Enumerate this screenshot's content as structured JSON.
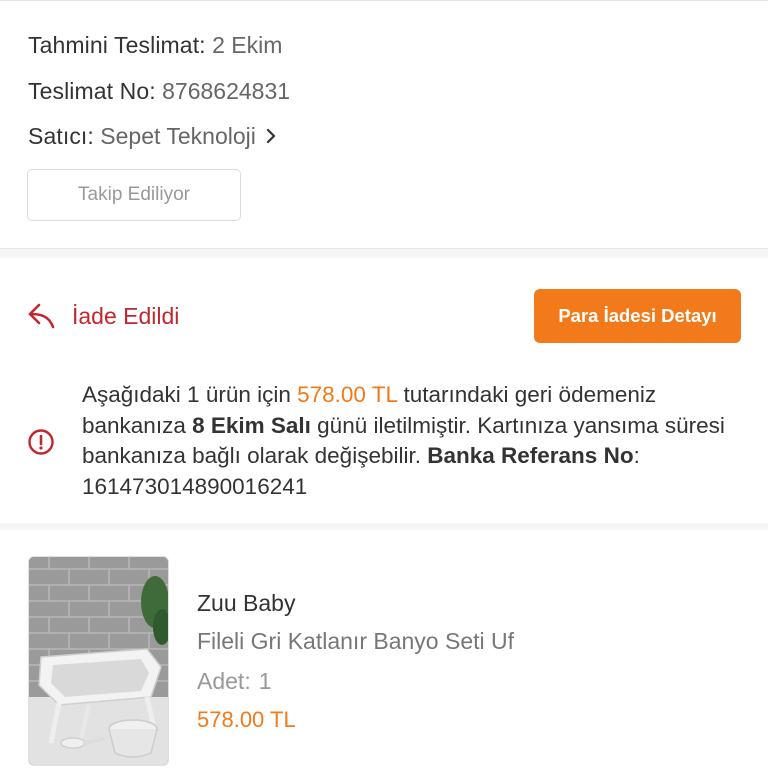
{
  "delivery": {
    "estimated_label": "Tahmini Teslimat:",
    "estimated_value": "2 Ekim",
    "number_label": "Teslimat No:",
    "number_value": "8768624831",
    "seller_label": "Satıcı:",
    "seller_value": "Sepet Teknoloji",
    "follow_button": "Takip Ediliyor"
  },
  "refund": {
    "status_label": "İade Edildi",
    "detail_button": "Para İadesi Detayı",
    "text_1": "Aşağıdaki 1 ürün için ",
    "amount": "578.00 TL",
    "text_2": " tutarındaki geri ödemeniz bankanıza ",
    "date": "8 Ekim Salı",
    "text_3": " günü iletilmiştir. Kartınıza yansıma süresi bankanıza bağlı olarak değişebilir. ",
    "ref_label": "Banka Referans No",
    "ref_value": ": 161473014890016241"
  },
  "product": {
    "brand": "Zuu Baby",
    "name": "Fileli Gri Katlanır Banyo Seti Uf",
    "qty_label": "Adet:",
    "qty_value": "1",
    "price": "578.00 TL"
  },
  "colors": {
    "accent": "#f27a1a",
    "returned_red": "#c2262e"
  },
  "icons": {
    "return": "undo-arrow-icon",
    "info": "info-circle-icon",
    "chevron": "chevron-right-icon"
  }
}
